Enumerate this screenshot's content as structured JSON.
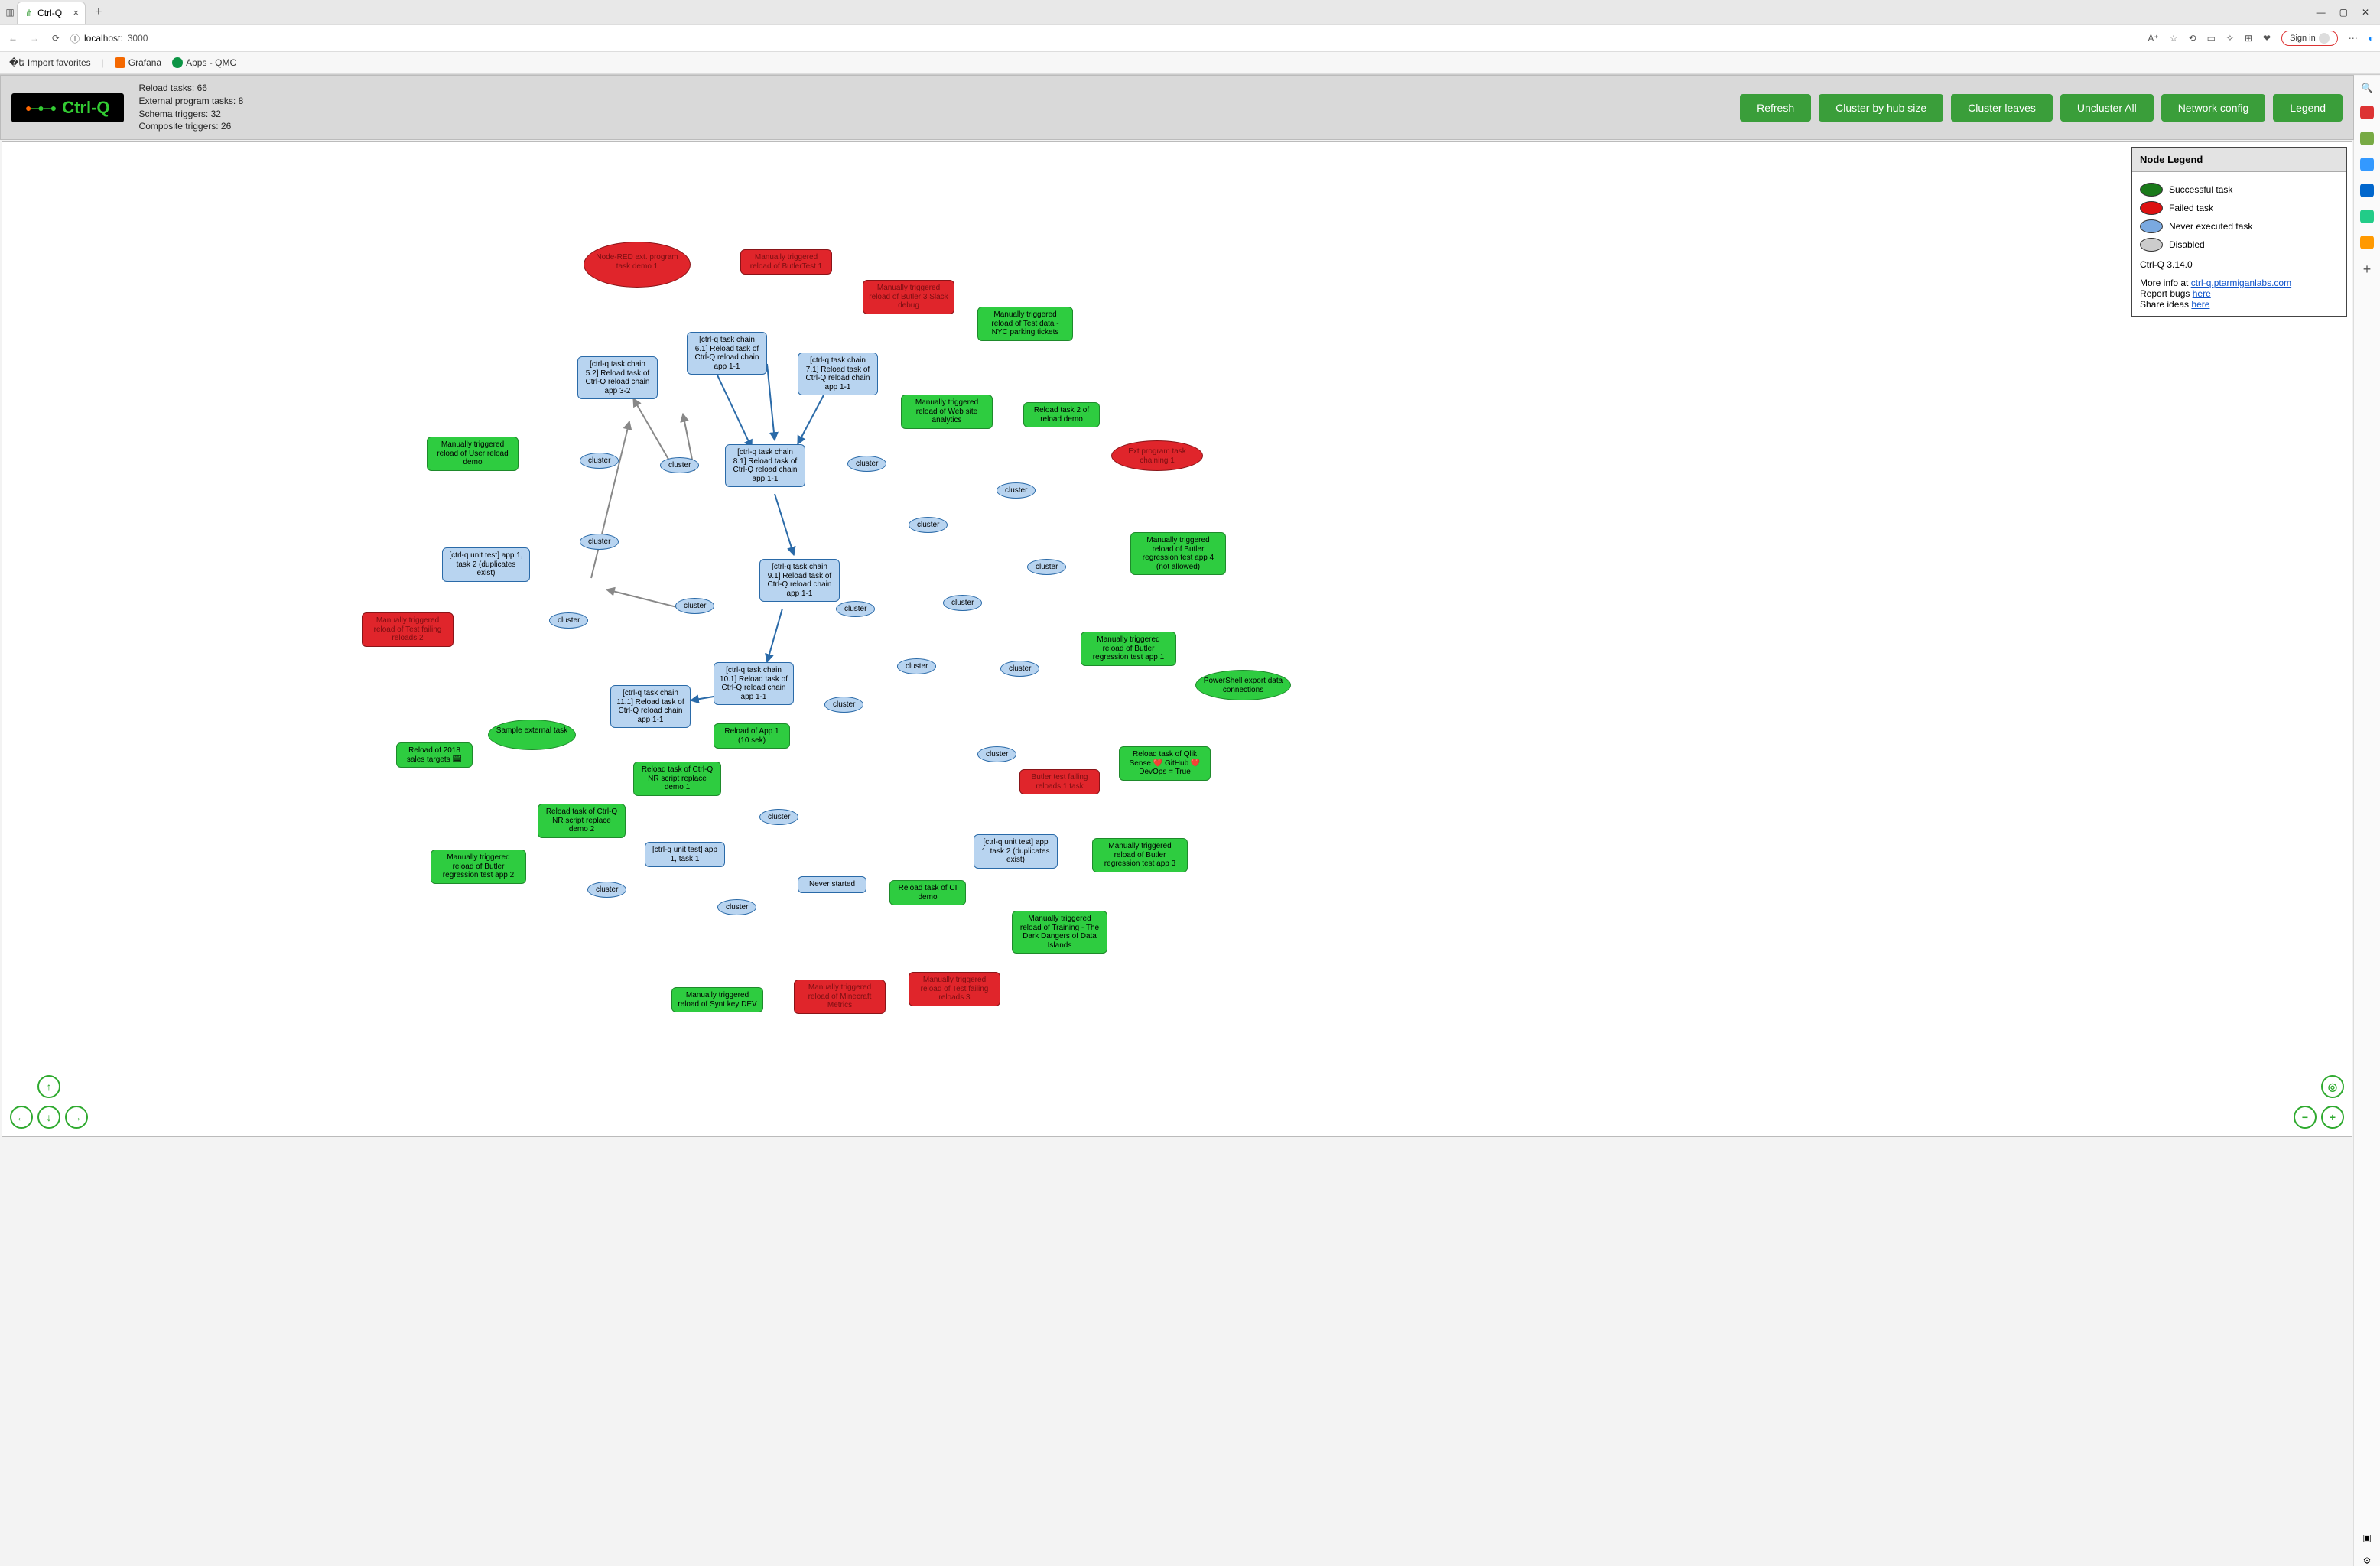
{
  "browser": {
    "tab_title": "Ctrl-Q",
    "newtab_label": "+",
    "url_prefix": "localhost:",
    "url_port": "3000",
    "signin_label": "Sign in",
    "bookmarks": {
      "import": "Import favorites",
      "grafana": "Grafana",
      "apps_qmc": "Apps - QMC"
    }
  },
  "app": {
    "logo_text": "Ctrl-Q",
    "stats": {
      "reload_tasks": "Reload tasks: 66",
      "external_program_tasks": "External program tasks: 8",
      "schema_triggers": "Schema triggers: 32",
      "composite_triggers": "Composite triggers: 26"
    },
    "buttons": {
      "refresh": "Refresh",
      "cluster_hub": "Cluster by hub size",
      "cluster_leaves": "Cluster leaves",
      "uncluster_all": "Uncluster All",
      "network_config": "Network config",
      "legend": "Legend"
    }
  },
  "legend": {
    "title": "Node Legend",
    "rows": {
      "successful": "Successful task",
      "failed": "Failed task",
      "never": "Never executed task",
      "disabled": "Disabled"
    },
    "version": "Ctrl-Q 3.14.0",
    "more_info_prefix": "More info at ",
    "more_info_link": "ctrl-q.ptarmiganlabs.com",
    "report_bugs_prefix": "Report bugs ",
    "share_ideas_prefix": "Share ideas ",
    "here": "here"
  },
  "cluster_label": "cluster",
  "nodes": {
    "n_nodered": "Node-RED ext. program task demo 1",
    "n_butlertest1": "Manually triggered reload of ButlerTest 1",
    "n_butler3": "Manually triggered reload of Butler 3 Slack debug",
    "n_nyc": "Manually triggered reload of Test data - NYC parking tickets",
    "n_chain61": "[ctrl-q task chain 6.1] Reload task of Ctrl-Q reload chain app 1-1",
    "n_chain52": "[ctrl-q task chain 5.2] Reload task of Ctrl-Q reload chain app 3-2",
    "n_chain71": "[ctrl-q task chain 7.1] Reload task of Ctrl-Q reload chain app 1-1",
    "n_chain81": "[ctrl-q task chain 8.1] Reload task of Ctrl-Q reload chain app 1-1",
    "n_chain91": "[ctrl-q task chain 9.1] Reload task of Ctrl-Q reload chain app 1-1",
    "n_chain101": "[ctrl-q task chain 10.1] Reload task of Ctrl-Q reload chain app 1-1",
    "n_chain111": "[ctrl-q task chain 11.1] Reload task of Ctrl-Q reload chain app 1-1",
    "n_website": "Manually triggered reload of Web site analytics",
    "n_reloaddemo2": "Reload task 2 of reload demo",
    "n_extchain1": "Ext program task chaining 1",
    "n_userreload": "Manually triggered reload of User reload demo",
    "n_unit_dup1": "[ctrl-q unit test] app 1, task 2 (duplicates exist)",
    "n_unit_dup2": "[ctrl-q unit test] app 1, task 2 (duplicates exist)",
    "n_unit1": "[ctrl-q unit test] app 1, task 1",
    "n_failing2": "Manually triggered reload of Test failing reloads 2",
    "n_regapp4": "Manually triggered reload of Butler regression test app 4 (not allowed)",
    "n_regapp1": "Manually triggered reload of Butler regression test app 1",
    "n_regapp2": "Manually triggered reload of Butler regression test app 2",
    "n_regapp3": "Manually triggered reload of Butler regression test app 3",
    "n_psexport": "PowerShell export data connections",
    "n_sampleext": "Sample external task",
    "n_sales2018": "Reload of 2018 sales targets 🗓",
    "n_app1_10s": "Reload of App 1 (10 sek)",
    "n_nrscript1": "Reload task of Ctrl-Q NR script replace demo 1",
    "n_nrscript2": "Reload task of Ctrl-Q NR script replace demo 2",
    "n_butlerfail1": "Butler test failing reloads 1 task",
    "n_github": "Reload task of Qlik Sense ❤️ GitHub ❤️ DevOps = True",
    "n_neverstarted": "Never started",
    "n_cidemo": "Reload task of CI demo",
    "n_training": "Manually triggered reload of Training - The Dark Dangers of Data Islands",
    "n_minecraft": "Manually triggered reload of Minecraft Metrics",
    "n_failing3": "Manually triggered reload of Test failing reloads 3",
    "n_syntkey": "Manually triggered reload of Synt key DEV"
  }
}
